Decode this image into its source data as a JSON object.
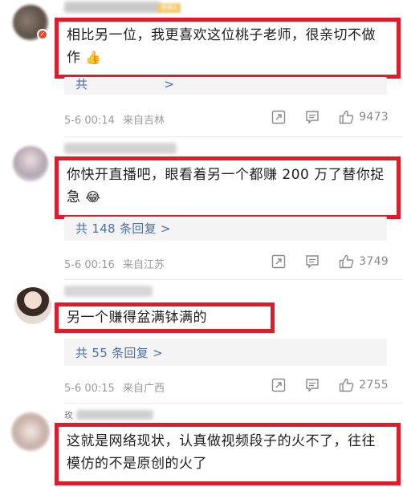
{
  "comments": [
    {
      "text": "相比另一位，我更喜欢这位桃子老师，很亲切不做作",
      "emoji": "thumbs-up-emoji",
      "reply_link": "共 ... 条回复 >",
      "reply_link_partial": "共",
      "date": "5-6 00:14",
      "location": "来自吉林",
      "likes": "9473"
    },
    {
      "text": "你快开直播吧，眼看着另一个都赚 200 万了替你捉急",
      "emoji": "laughing-tears-emoji",
      "reply_link": "共 148 条回复 >",
      "date": "5-6 00:16",
      "location": "来自江苏",
      "likes": "3749"
    },
    {
      "text": "另一个赚得盆满钵满的",
      "reply_link": "共 55 条回复 >",
      "date": "5-6 00:15",
      "location": "来自广西",
      "likes": "2755"
    },
    {
      "text": "这就是网络现状，认真做视频段子的火不了，往往模仿的不是原创的火了",
      "username_partial": "玫"
    }
  ],
  "fan_badge": "铁粉1",
  "icons": {
    "share": "share-icon",
    "comment": "comment-icon",
    "like": "like-icon"
  },
  "colors": {
    "highlight_border": "#e01c2a",
    "reply_link": "#4b6fa8",
    "meta": "#9a9a9a"
  }
}
